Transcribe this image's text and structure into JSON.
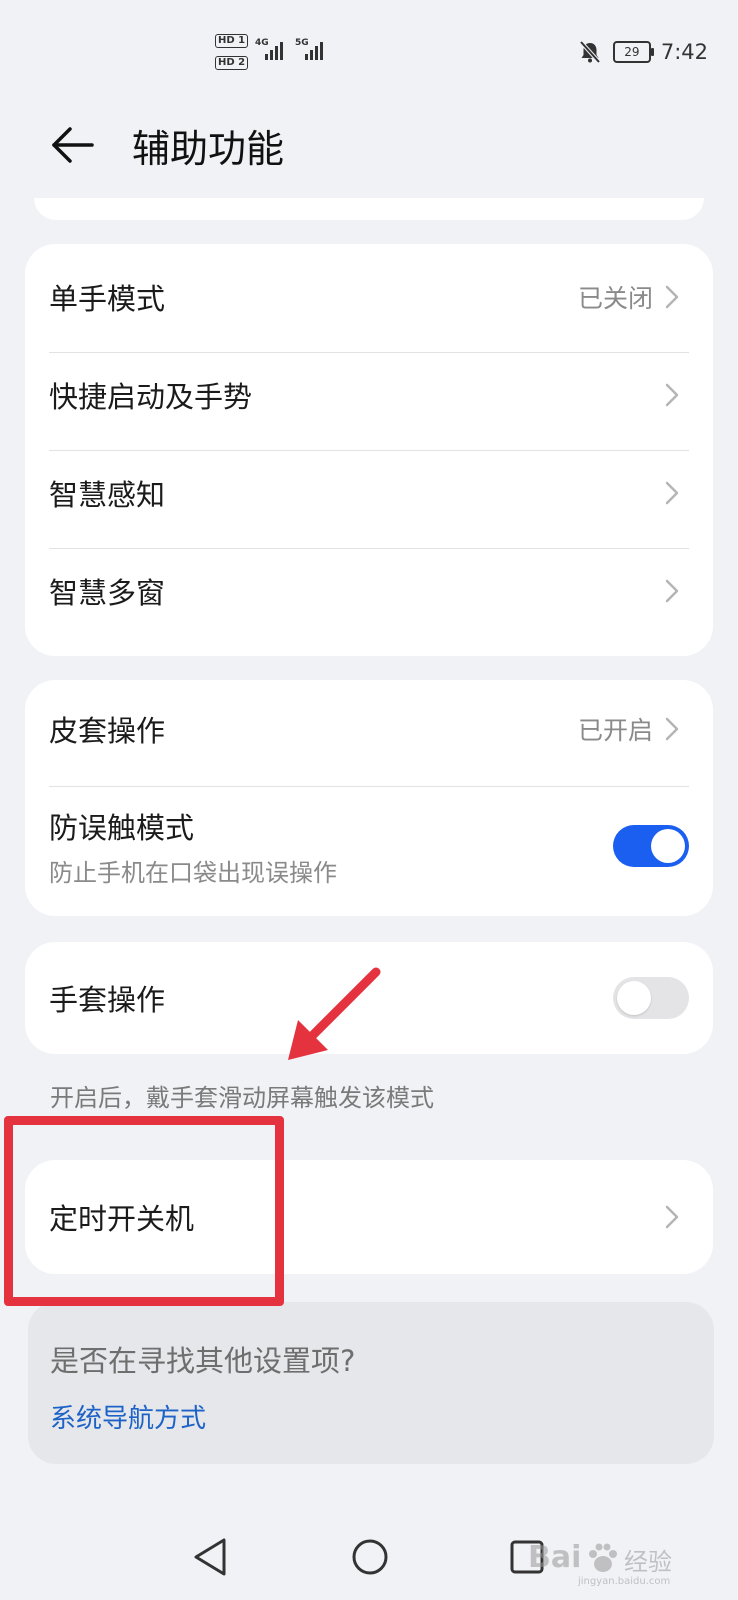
{
  "status_bar": {
    "sim1": "HD 1",
    "sim2": "HD 2",
    "net1": "4G",
    "net2": "5G",
    "battery": "29",
    "time": "7:42"
  },
  "header": {
    "title": "辅助功能"
  },
  "group1": {
    "one_hand": {
      "label": "单手模式",
      "value": "已关闭"
    },
    "quick_launch": {
      "label": "快捷启动及手势"
    },
    "smart_sense": {
      "label": "智慧感知"
    },
    "smart_multiwindow": {
      "label": "智慧多窗"
    }
  },
  "group2": {
    "cover": {
      "label": "皮套操作",
      "value": "已开启"
    },
    "pocket_mode": {
      "label": "防误触模式",
      "subtitle": "防止手机在口袋出现误操作",
      "enabled": true
    }
  },
  "group3": {
    "glove": {
      "label": "手套操作",
      "enabled": false
    },
    "hint": "开启后，戴手套滑动屏幕触发该模式"
  },
  "group4": {
    "scheduled_power": {
      "label": "定时开关机"
    }
  },
  "suggestion": {
    "question": "是否在寻找其他设置项?",
    "link": "系统导航方式"
  },
  "watermark": {
    "brand": "Bai",
    "cn": "经验",
    "url": "jingyan.baidu.com"
  },
  "colors": {
    "accent": "#1a5ff0",
    "link": "#1d63c7",
    "annotation": "#e5323f"
  }
}
